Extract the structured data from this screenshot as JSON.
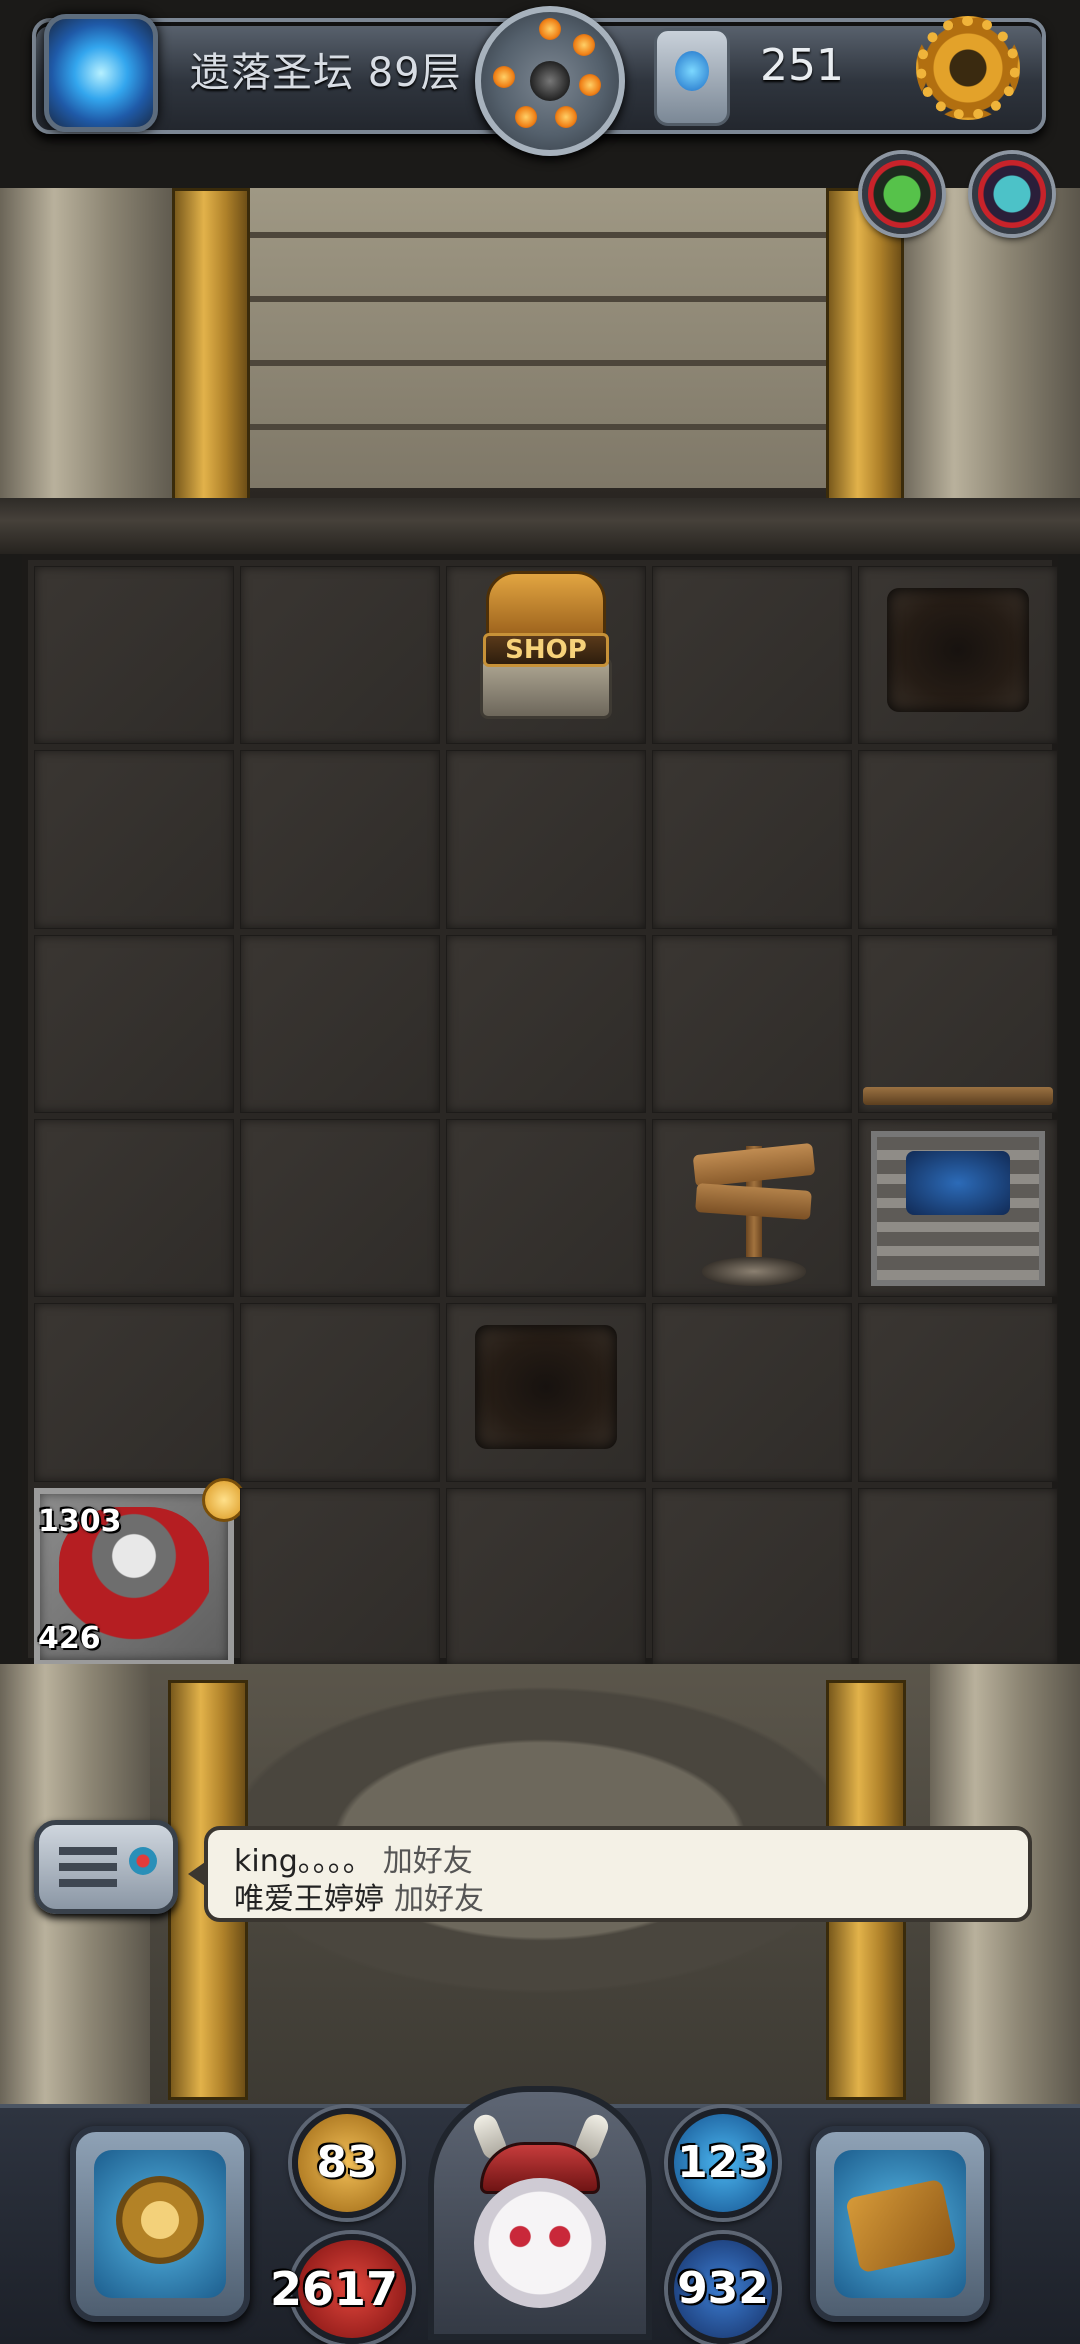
{
  "top_bar": {
    "floor_title": "遗落圣坛 89层",
    "gem_count": "251"
  },
  "board": {
    "cols": 5,
    "rows": 6,
    "shop_label": "SHOP",
    "hero": {
      "hp": "1303",
      "attack": "426"
    }
  },
  "chat": {
    "messages": [
      {
        "user": "king。。。。",
        "action": "加好友"
      },
      {
        "user": "唯爱王婷婷",
        "action": "加好友"
      }
    ]
  },
  "hud": {
    "attack": "83",
    "hp": "2617",
    "mana": "123",
    "defense": "932"
  },
  "icons": {
    "portal": "portal-icon",
    "bomb_wheel": "bomb-wheel-icon",
    "gem": "gem-icon",
    "settings": "gear-icon",
    "cooldown_1": "monster-cooldown-icon",
    "cooldown_2": "monster-cooldown-icon",
    "chat": "chat-icon",
    "equipment": "equipment-icon",
    "spellbook": "spellbook-icon"
  },
  "colors": {
    "accent_gold": "#e2b24a",
    "hp_red": "#c8232a",
    "mana_blue": "#4bb6f0"
  }
}
